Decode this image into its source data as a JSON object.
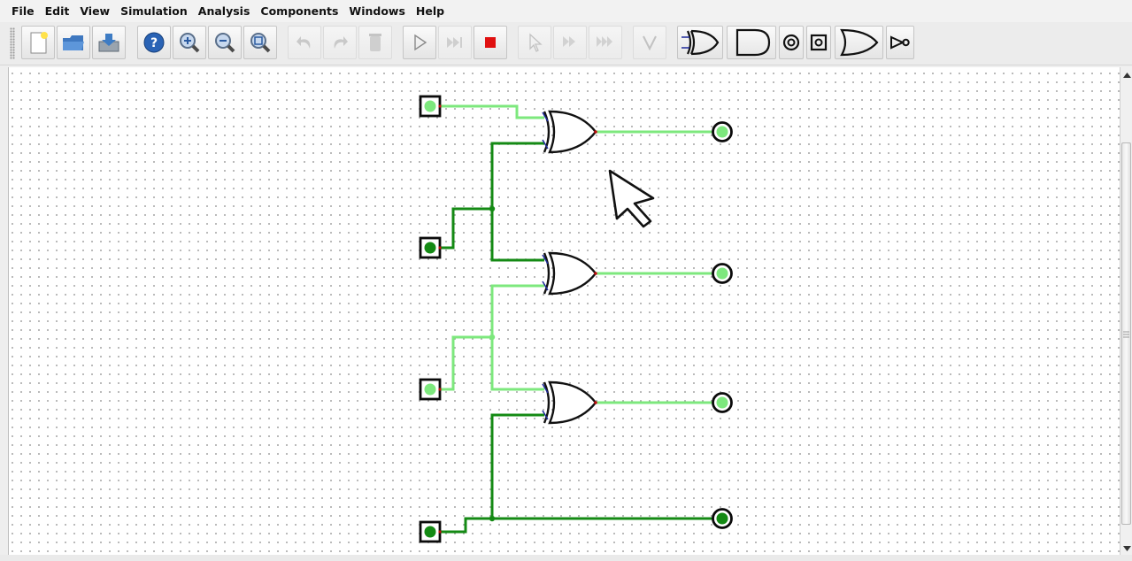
{
  "menu": {
    "file": "File",
    "edit": "Edit",
    "view": "View",
    "simulation": "Simulation",
    "analysis": "Analysis",
    "components": "Components",
    "windows": "Windows",
    "help": "Help"
  },
  "toolbar": {
    "buttons": [
      "new-file",
      "open-folder",
      "save",
      "help",
      "zoom-in",
      "zoom-out",
      "zoom-fit",
      "undo",
      "redo",
      "delete",
      "run-simulation",
      "step-simulation",
      "stop-simulation",
      "select-pointer",
      "step-forward",
      "fast-forward",
      "wire-tool",
      "xor-gate",
      "and-gate",
      "led-output",
      "probe",
      "or-gate",
      "not-gate"
    ]
  },
  "colors": {
    "wire_high": "#7de87d",
    "wire_low": "#148a14",
    "gate_stroke": "#111111",
    "pin_stroke": "#0b0b0b",
    "stop_red": "#e01010"
  },
  "circuit": {
    "inputs": [
      {
        "name": "input-1",
        "state": "high"
      },
      {
        "name": "input-2",
        "state": "low"
      },
      {
        "name": "input-3",
        "state": "high"
      },
      {
        "name": "input-4",
        "state": "low"
      }
    ],
    "gates": [
      {
        "type": "xor",
        "output": "high"
      },
      {
        "type": "xor",
        "output": "high"
      },
      {
        "type": "xor",
        "output": "high"
      }
    ],
    "outputs": [
      {
        "name": "output-1",
        "state": "high"
      },
      {
        "name": "output-2",
        "state": "high"
      },
      {
        "name": "output-3",
        "state": "high"
      },
      {
        "name": "output-4",
        "state": "low"
      }
    ]
  }
}
